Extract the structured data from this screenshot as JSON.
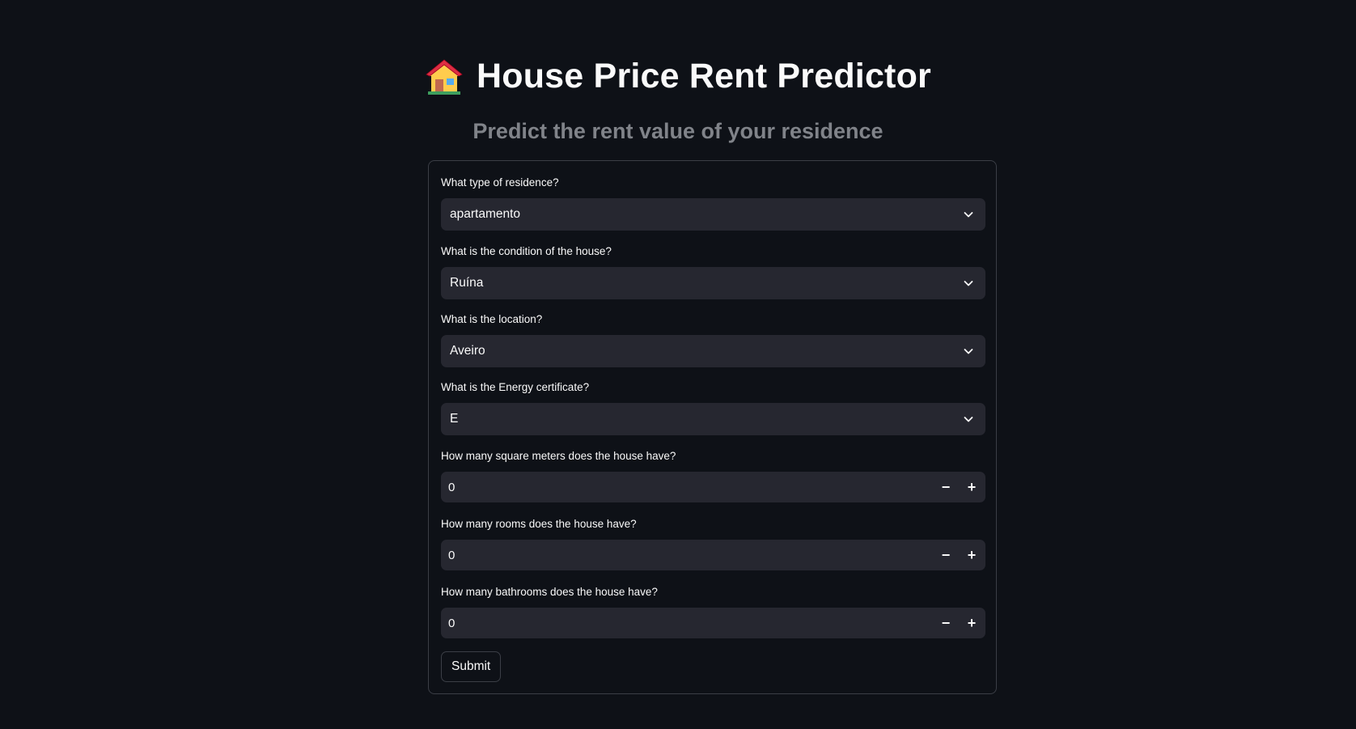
{
  "header": {
    "icon": "house-icon",
    "title": "House Price Rent Predictor",
    "subtitle": "Predict the rent value of your residence"
  },
  "form": {
    "residence_type": {
      "label": "What type of residence?",
      "value": "apartamento",
      "icon": "chevron-down-icon"
    },
    "condition": {
      "label": "What is the condition of the house?",
      "value": "Ruína",
      "icon": "chevron-down-icon"
    },
    "location": {
      "label": "What is the location?",
      "value": "Aveiro",
      "icon": "chevron-down-icon"
    },
    "energy_certificate": {
      "label": "What is the Energy certificate?",
      "value": "E",
      "icon": "chevron-down-icon"
    },
    "square_meters": {
      "label": "How many square meters does the house have?",
      "value": "0",
      "minus": "−",
      "plus": "+"
    },
    "rooms": {
      "label": "How many rooms does the house have?",
      "value": "0",
      "minus": "−",
      "plus": "+"
    },
    "bathrooms": {
      "label": "How many bathrooms does the house have?",
      "value": "0",
      "minus": "−",
      "plus": "+"
    },
    "submit_label": "Submit"
  },
  "colors": {
    "background": "#0e1117",
    "input_background": "#262730",
    "border": "#3b3e46",
    "text": "#fafafa",
    "subtitle": "#808389"
  }
}
